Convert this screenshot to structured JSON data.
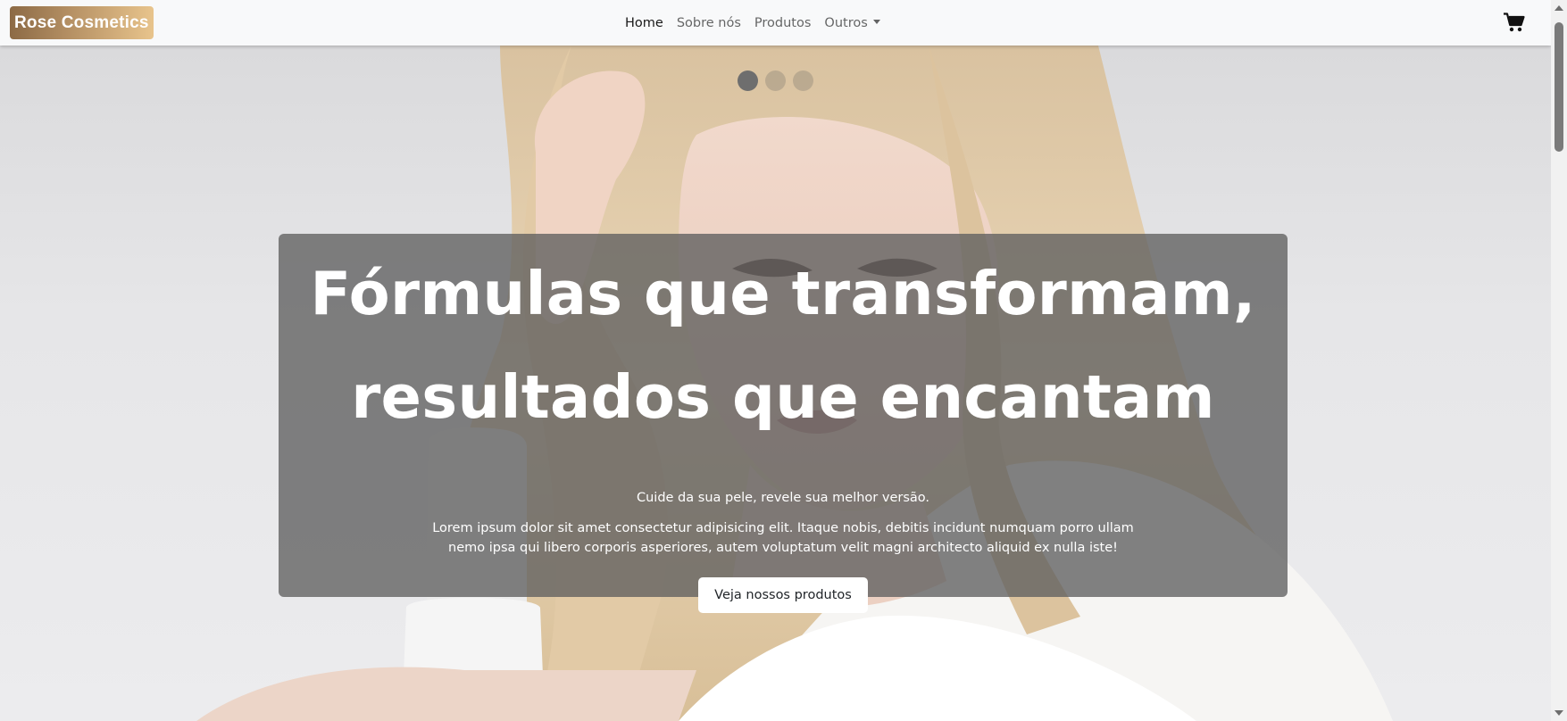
{
  "navbar": {
    "brand": "Rose Cosmetics",
    "links": [
      {
        "label": "Home"
      },
      {
        "label": "Sobre nós"
      },
      {
        "label": "Produtos"
      },
      {
        "label": "Outros"
      }
    ],
    "cart_icon": "shopping-cart-icon"
  },
  "hero": {
    "slides_count": 3,
    "active_slide": 1,
    "title_line1": "Fórmulas que transformam,",
    "title_line2": "resultados que encantam",
    "subtitle": "Cuide da sua pele, revele sua melhor versão.",
    "lorem": "Lorem ipsum dolor sit amet consectetur adipisicing elit. Itaque nobis, debitis incidunt numquam porro ullam nemo ipsa qui libero corporis asperiores, autem voluptatum velit magni architecto aliquid ex nulla iste!",
    "cta": "Veja nossos produtos"
  },
  "colors": {
    "navbar_bg": "#f8f9fa",
    "brand_gradient_start": "#8c6a45",
    "brand_gradient_end": "#e8c48c",
    "caption_bg": "#5f5f5f",
    "hair": "#e5cfae"
  }
}
